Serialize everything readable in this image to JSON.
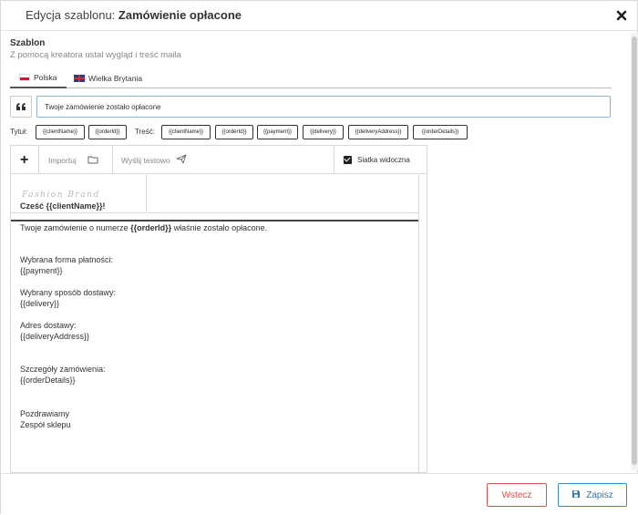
{
  "header": {
    "title_prefix": "Edycja szablonu: ",
    "title_name": "Zamówienie opłacone",
    "close_icon": "close-icon"
  },
  "section": {
    "title": "Szablon",
    "subtitle": "Z pomocą kreatora ustal wygląd i treść maila"
  },
  "tabs": [
    {
      "label": "Polska",
      "flag": "flag-poland-icon",
      "active": true
    },
    {
      "label": "Wielka Brytania",
      "flag": "flag-uk-icon",
      "active": false
    }
  ],
  "subject": {
    "icon": "quote-icon",
    "value": "Twoje zamówienie zostało opłacone"
  },
  "variables": {
    "title_label": "Tytuł:",
    "title_vars": [
      "{{clientName}}",
      "{{orderId}}"
    ],
    "body_label": "Treść:",
    "body_vars": [
      "{{clientName}}",
      "{{orderId}}",
      "{{payment}}",
      "{{delivery}}",
      "{{deliveryAddress}}",
      "{{orderDetails}}"
    ]
  },
  "toolbar": {
    "add_icon": "plus-icon",
    "import_label": "Importuj",
    "import_icon": "folder-icon",
    "send_test_label": "Wyślij testowo",
    "send_icon": "send-icon",
    "grid_label": "Siatka widoczna",
    "grid_checked": true
  },
  "canvas": {
    "logo_text": "Fashion Brand"
  },
  "mail": {
    "greeting": "Cześć {{clientName}}!",
    "line1_prefix": "Twoje zamówienie o numerze ",
    "line1_var": "{{orderId}}",
    "line1_suffix": " właśnie zostało opłacone.",
    "payment_label": "Wybrana forma płatności:",
    "payment_var": "{{payment}}",
    "delivery_label": "Wybrany sposób dostawy:",
    "delivery_var": "{{delivery}}",
    "address_label": "Adres dostawy:",
    "address_var": "{{deliveryAddress}}",
    "details_label": "Szczegóły zamówienia:",
    "details_var": "{{orderDetails}}",
    "regards": "Pozdrawiamy",
    "signature": "Zespół sklepu"
  },
  "footer": {
    "back_label": "Wstecz",
    "save_label": "Zapisz",
    "save_icon": "floppy-disk-icon"
  },
  "colors": {
    "back_button": "#d9534f",
    "save_button": "#3a8bc4",
    "subject_border": "#8fb5d6"
  }
}
